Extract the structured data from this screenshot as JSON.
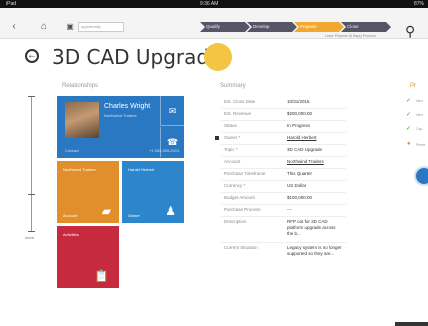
{
  "status_bar": {
    "left": "iPad",
    "time": "9:36 AM",
    "battery": "87%"
  },
  "nav": {
    "back_glyph": "‹",
    "home_glyph": "⌂",
    "search_text": "opportunity"
  },
  "process": {
    "stages": [
      {
        "label": "Qualify",
        "active": false
      },
      {
        "label": "Develop",
        "active": false
      },
      {
        "label": "Propose",
        "active": true
      },
      {
        "label": "Close",
        "active": false
      }
    ],
    "caption": "Lead: Propose (5 Days) Process"
  },
  "page": {
    "title": "3D CAD Upgrade",
    "status_color": "#f4c542"
  },
  "relationships": {
    "label": "Relationships",
    "slider_label": "more",
    "contact": {
      "name": "Charles Wright",
      "subtitle": "Northwind Traders",
      "role": "Contact",
      "phone": "+1 555-555-0101"
    },
    "tiles": [
      {
        "label": "Northwind Traders",
        "footer": "Account",
        "icon": "briefcase-icon",
        "color": "#e08f2a"
      },
      {
        "label": "Harold Herbert",
        "footer": "Owner",
        "icon": "person-icon",
        "color": "#2d86cc"
      },
      {
        "label": "Activities",
        "footer": "",
        "icon": "clipboard-icon",
        "color": "#c52a3e"
      }
    ]
  },
  "summary": {
    "label": "Summary",
    "rows": [
      {
        "label": "Est. Close Date",
        "value": "10/31/2015",
        "link": false,
        "required": false
      },
      {
        "label": "Est. Revenue",
        "value": "$200,000.00",
        "link": false,
        "required": false
      },
      {
        "label": "Status",
        "value": "In Progress",
        "link": false,
        "required": false
      },
      {
        "label": "Owner *",
        "value": "Harold Herbert",
        "link": true,
        "required": true
      },
      {
        "label": "Topic *",
        "value": "3D CAD Upgrade",
        "link": false,
        "required": false
      },
      {
        "label": "Account",
        "value": "Northwind Traders",
        "link": true,
        "required": false
      },
      {
        "label": "Purchase Timeframe",
        "value": "This Quarter",
        "link": false,
        "required": false
      },
      {
        "label": "Currency *",
        "value": "US Dollar",
        "link": false,
        "required": false
      },
      {
        "label": "Budget Amount",
        "value": "$100,000.00",
        "link": false,
        "required": false
      },
      {
        "label": "Purchase Process",
        "value": "---",
        "link": false,
        "required": false
      },
      {
        "label": "Description",
        "value": "RFP out for 3D CAD platform upgrade across the b...",
        "link": false,
        "required": false
      },
      {
        "label": "Current Situation",
        "value": "Legacy system is no longer supported so they are...",
        "link": false,
        "required": false
      }
    ]
  },
  "right_panel": {
    "title": "Pr",
    "items": [
      "Iden",
      "Iden",
      "Cap",
      "Prese"
    ]
  }
}
